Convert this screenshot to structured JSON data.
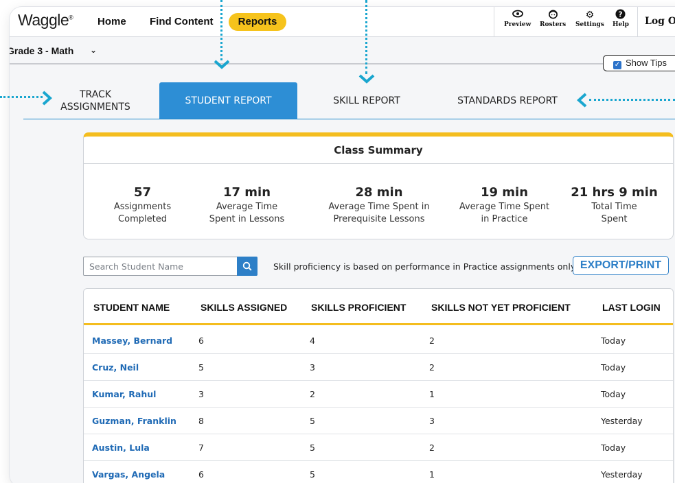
{
  "app": {
    "logo": "Waggle",
    "logo_mark": "®"
  },
  "nav": {
    "home": "Home",
    "find_content": "Find Content",
    "reports": "Reports",
    "tools": [
      {
        "label": "Preview",
        "icon": "eye-icon"
      },
      {
        "label": "Rosters",
        "icon": "student-face-icon"
      },
      {
        "label": "Settings",
        "icon": "gear-icon"
      },
      {
        "label": "Help",
        "icon": "help-icon"
      }
    ],
    "logout": "Log Ou"
  },
  "grade": {
    "selected": "Grade 3 - Math"
  },
  "show_tips": {
    "label": "Show Tips",
    "checked": true
  },
  "tabs": [
    {
      "label": "TRACK ASSIGNMENTS",
      "active": false
    },
    {
      "label": "STUDENT REPORT",
      "active": true
    },
    {
      "label": "SKILL REPORT",
      "active": false
    },
    {
      "label": "STANDARDS REPORT",
      "active": false
    }
  ],
  "summary": {
    "title": "Class Summary",
    "stats": [
      {
        "value": "57",
        "label": "Assignments Completed"
      },
      {
        "value": "17 min",
        "label": "Average Time Spent in Lessons"
      },
      {
        "value": "28 min",
        "label": "Average Time Spent in Prerequisite Lessons"
      },
      {
        "value": "19 min",
        "label": "Average Time Spent in Practice"
      },
      {
        "value": "21 hrs 9 min",
        "label": "Total Time Spent"
      }
    ]
  },
  "search": {
    "placeholder": "Search Student Name"
  },
  "note": "Skill proficiency is based on performance in Practice assignments only.",
  "export_label": "EXPORT/PRINT",
  "table": {
    "headers": [
      "STUDENT NAME",
      "SKILLS ASSIGNED",
      "SKILLS PROFICIENT",
      "SKILLS NOT YET PROFICIENT",
      "LAST LOGIN"
    ],
    "rows": [
      [
        "Massey, Bernard",
        "6",
        "4",
        "2",
        "Today"
      ],
      [
        "Cruz, Neil",
        "5",
        "3",
        "2",
        "Today"
      ],
      [
        "Kumar, Rahul",
        "3",
        "2",
        "1",
        "Today"
      ],
      [
        "Guzman, Franklin",
        "8",
        "5",
        "3",
        "Yesterday"
      ],
      [
        "Austin, Lula",
        "7",
        "5",
        "2",
        "Today"
      ],
      [
        "Vargas, Angela",
        "6",
        "5",
        "1",
        "Yesterday"
      ]
    ]
  },
  "colors": {
    "accent_blue": "#2d8ed5",
    "highlight_yellow": "#f6c31c",
    "tip_dots": "#1aa6cf",
    "link_blue": "#1f6ab5"
  }
}
